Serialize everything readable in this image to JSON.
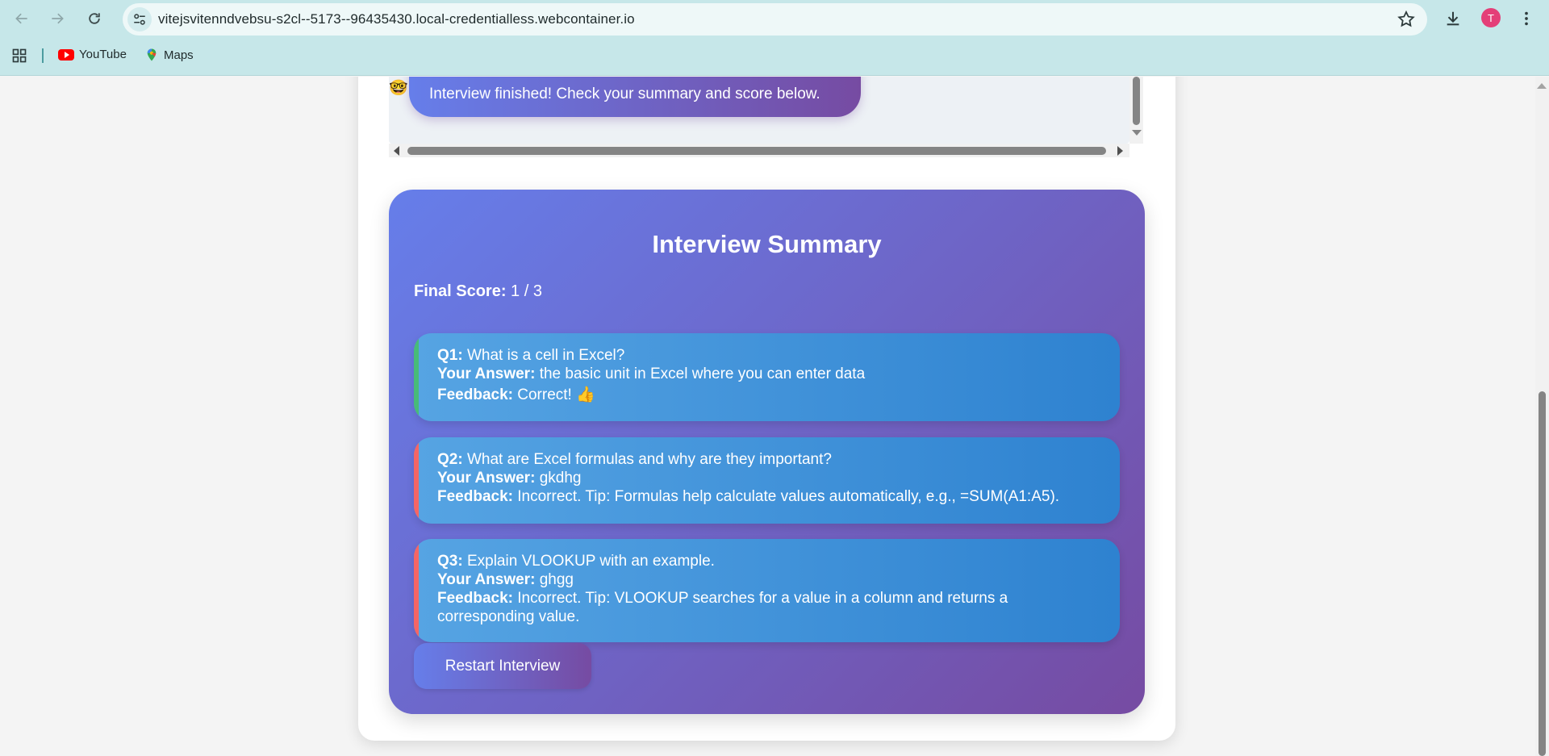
{
  "browser": {
    "url": "vitejsvitenndvebsu-s2cl--5173--96435430.local-credentialless.webcontainer.io",
    "profile_initial": "T",
    "bookmarks": [
      {
        "label": "YouTube",
        "icon": "youtube-icon"
      },
      {
        "label": "Maps",
        "icon": "maps-icon"
      }
    ]
  },
  "chat": {
    "bot_icon": "🤓",
    "last_message": "Interview finished! Check your summary and score below."
  },
  "summary": {
    "title": "Interview Summary",
    "score_label": "Final Score:",
    "score_value": "1 / 3",
    "question_label": "Q1:",
    "answer_label": "Your Answer:",
    "feedback_label": "Feedback:",
    "items": [
      {
        "q_label": "Q1:",
        "question": "What is a cell in Excel?",
        "answer": "the basic unit in Excel where you can enter data",
        "feedback": "Correct!",
        "emoji": "👍",
        "status": "correct"
      },
      {
        "q_label": "Q2:",
        "question": "What are Excel formulas and why are they important?",
        "answer": "gkdhg",
        "feedback": "Incorrect. Tip: Formulas help calculate values automatically, e.g., =SUM(A1:A5).",
        "emoji": "",
        "status": "incorrect"
      },
      {
        "q_label": "Q3:",
        "question": "Explain VLOOKUP with an example.",
        "answer": "ghgg",
        "feedback": "Incorrect. Tip: VLOOKUP searches for a value in a column and returns a corresponding value.",
        "emoji": "",
        "status": "incorrect"
      }
    ],
    "restart_label": "Restart Interview"
  },
  "colors": {
    "gradient_start": "#667eea",
    "gradient_end": "#764ba2",
    "card_start": "#56a4e3",
    "card_end": "#2e82d0",
    "correct": "#48bb78",
    "incorrect": "#f56565"
  }
}
